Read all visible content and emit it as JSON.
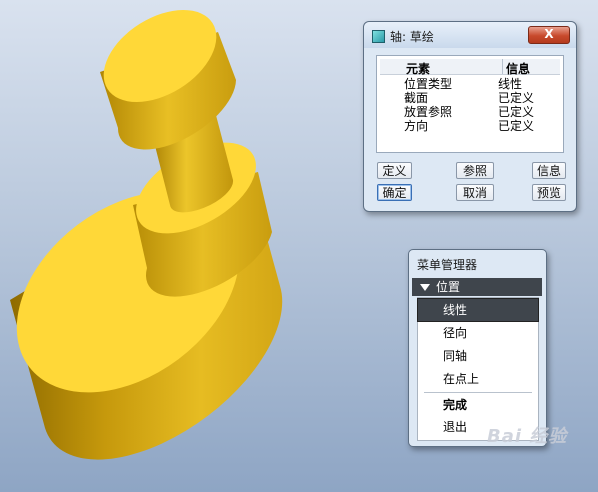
{
  "dialog": {
    "title": "轴: 草绘",
    "close_label": "X",
    "columns": {
      "element": "元素",
      "info": "信息"
    },
    "rows": [
      {
        "element": "位置类型",
        "info": "线性"
      },
      {
        "element": "截面",
        "info": "已定义"
      },
      {
        "element": "放置参照",
        "info": "已定义"
      },
      {
        "element": "方向",
        "info": "已定义"
      }
    ],
    "buttons": {
      "define": "定义",
      "refs": "参照",
      "info": "信息",
      "ok": "确定",
      "cancel": "取消",
      "preview": "预览"
    }
  },
  "menu_manager": {
    "title": "菜单管理器",
    "section": "位置",
    "items": [
      {
        "label": "线性",
        "selected": true
      },
      {
        "label": "径向"
      },
      {
        "label": "同轴"
      },
      {
        "label": "在点上"
      }
    ],
    "done": "完成",
    "quit": "退出"
  },
  "watermark": "Bai 经验",
  "colors": {
    "model_top": "#ffd838",
    "model_side": "#e0b51c",
    "model_shadow": "#8f6b00",
    "background_top": "#d9e2ef",
    "background_bottom": "#8ea5c4",
    "menu_highlight": "#3f454c",
    "close_button": "#c84a2c"
  },
  "icons": {
    "app": "window-app-icon",
    "close": "close-icon",
    "section_toggle": "triangle-down-icon"
  }
}
